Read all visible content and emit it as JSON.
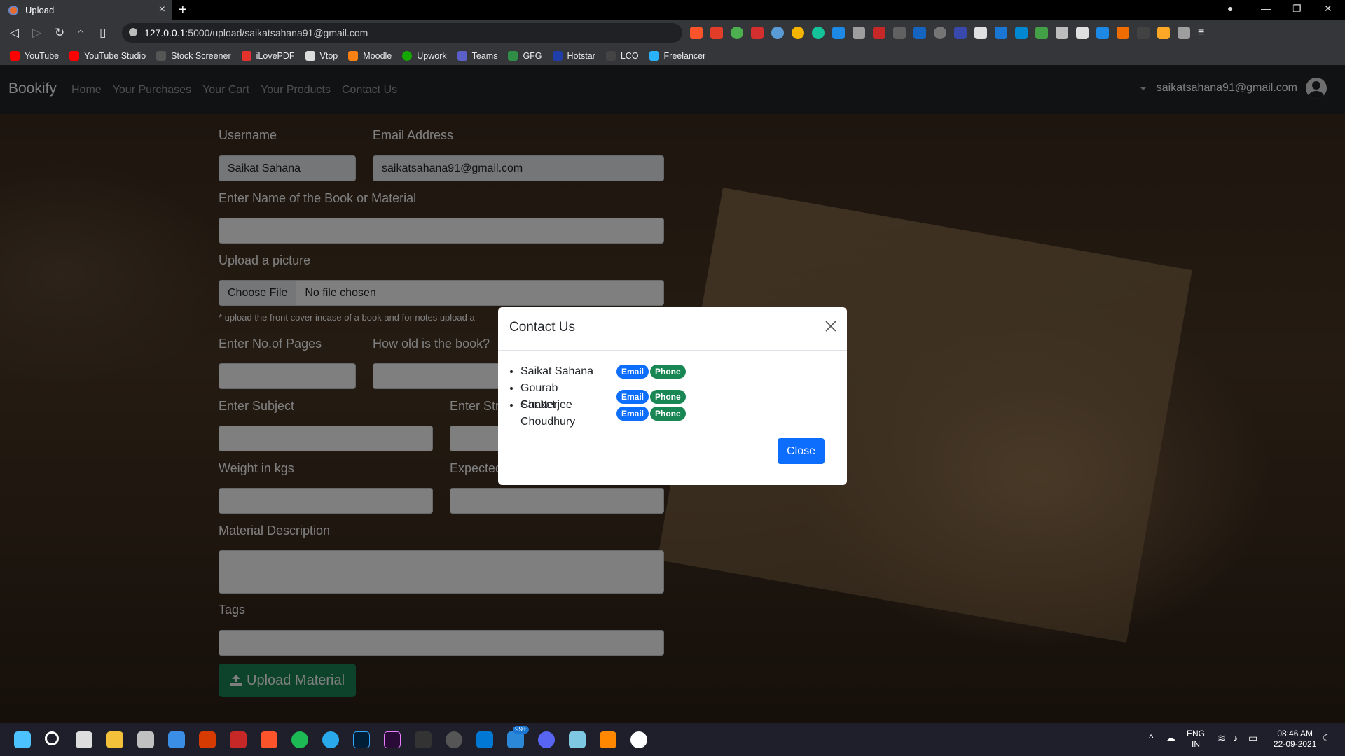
{
  "browser": {
    "tab_title": "Upload",
    "url_host": "127.0.0.1",
    "url_rest": ":5000/upload/saikatsahana91@gmail.com",
    "bookmarks": [
      {
        "label": "YouTube",
        "color": "#ff0000"
      },
      {
        "label": "YouTube Studio",
        "color": "#ff0000"
      },
      {
        "label": "Stock Screener",
        "color": "#2b2b2b"
      },
      {
        "label": "iLovePDF",
        "color": "#e5322d"
      },
      {
        "label": "Vtop",
        "color": "#dddddd"
      },
      {
        "label": "Moodle",
        "color": "#f98012"
      },
      {
        "label": "Upwork",
        "color": "#14a800"
      },
      {
        "label": "Teams",
        "color": "#5b5fc7"
      },
      {
        "label": "GFG",
        "color": "#2f8d46"
      },
      {
        "label": "Hotstar",
        "color": "#1f3ea8"
      },
      {
        "label": "LCO",
        "color": "#444444"
      },
      {
        "label": "Freelancer",
        "color": "#29b2fe"
      }
    ]
  },
  "app": {
    "brand": "Bookify",
    "nav": [
      "Home",
      "Your Purchases",
      "Your Cart",
      "Your Products",
      "Contact Us"
    ],
    "user_email": "saikatsahana91@gmail.com"
  },
  "form": {
    "username_label": "Username",
    "username_value": "Saikat Sahana",
    "email_label": "Email Address",
    "email_value": "saikatsahana91@gmail.com",
    "book_name_label": "Enter Name of the Book or Material",
    "picture_label": "Upload a picture",
    "choose_file": "Choose File",
    "no_file": "No file chosen",
    "picture_hint": "* upload the front cover incase of a book and for notes upload a",
    "pages_label": "Enter No.of Pages",
    "age_label": "How old is the book?",
    "subject_label": "Enter Subject",
    "stream_label": "Enter Str",
    "weight_label": "Weight in kgs",
    "expected_label": "Expected",
    "description_label": "Material Description",
    "tags_label": "Tags",
    "upload_button": "Upload Material"
  },
  "modal": {
    "title": "Contact Us",
    "contacts": [
      {
        "name": "Saikat Sahana",
        "email": "Email",
        "phone": "Phone"
      },
      {
        "name": "Gourab Chatterjee",
        "email": "Email",
        "phone": "Phone"
      },
      {
        "name": "Sanket Choudhury",
        "email": "Email",
        "phone": "Phone"
      }
    ],
    "close_button": "Close"
  },
  "taskbar": {
    "lang_1": "ENG",
    "lang_2": "IN",
    "time": "08:46 AM",
    "date": "22-09-2021",
    "notification_badge": "99+"
  }
}
